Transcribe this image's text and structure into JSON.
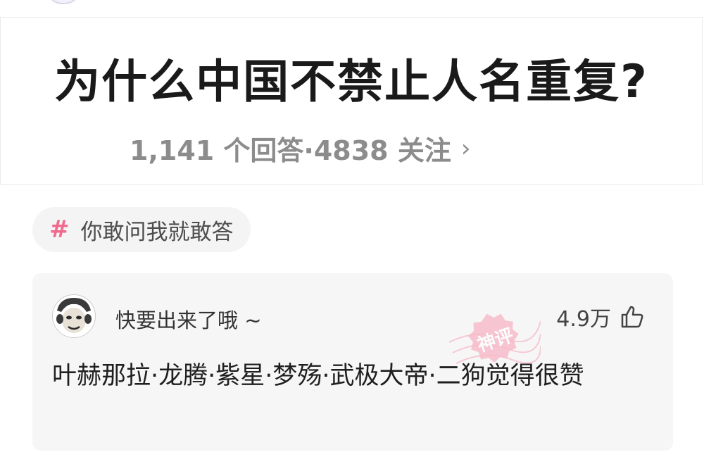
{
  "question": {
    "title": "为什么中国不禁止人名重复?",
    "meta": "1,141 个回答·4838 关注",
    "chevron": "›"
  },
  "topic": {
    "hash_symbol": "#",
    "label": "你敢问我就敢答"
  },
  "comment": {
    "username": "快要出来了哦 ~",
    "likes": "4.9万",
    "text": "叶赫那拉·龙腾·紫星·梦殇·武极大帝·二狗觉得很赞",
    "badge": "神评",
    "avatar_icon": "meme-face-avatar",
    "like_icon": "thumbs-up-icon"
  },
  "colors": {
    "accent_pink": "#f06a8e",
    "meta_gray": "#8c8c8c",
    "card_bg": "#f6f6f6"
  }
}
